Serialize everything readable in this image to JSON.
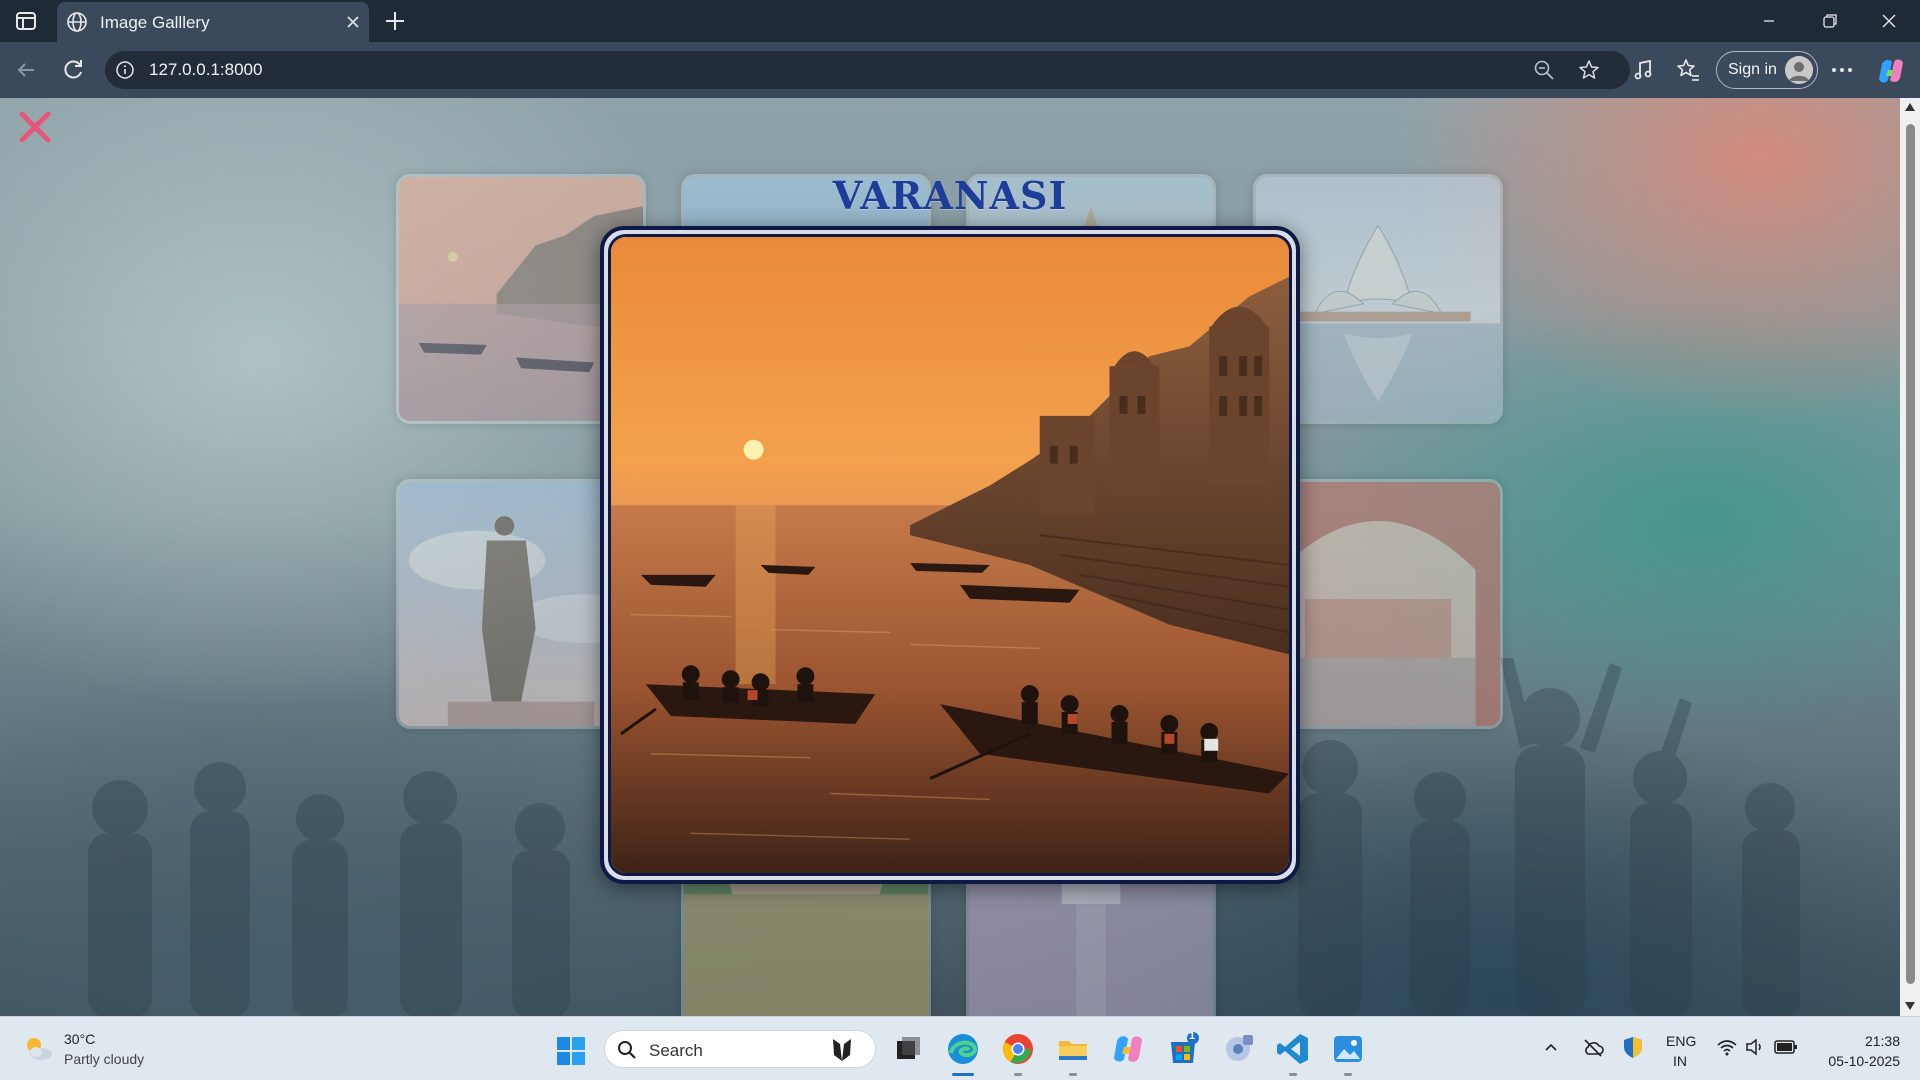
{
  "browser": {
    "tab_title": "Image Galllery",
    "url": "127.0.0.1:8000",
    "signin_label": "Sign in"
  },
  "gallery": {
    "modal_title": "VARANASI",
    "modal_image_alt": "Varanasi ghats at sunset with boats",
    "thumbnails": [
      {
        "subject": "Varanasi ghats sunset"
      },
      {
        "subject": "Coastal scene"
      },
      {
        "subject": "Temple"
      },
      {
        "subject": "Lotus Temple"
      },
      {
        "subject": "Statue of Unity"
      },
      {
        "subject": "Hawa Mahal"
      },
      {
        "subject": "Kerala houseboat"
      },
      {
        "subject": "Taj Mahal"
      }
    ]
  },
  "colors": {
    "title_blue": "#1e3d9a",
    "close_pink": "#e8557a",
    "frame_navy": "#0e1a45"
  },
  "taskbar": {
    "weather_temp": "30°C",
    "weather_desc": "Partly cloudy",
    "search_label": "Search",
    "store_badge": "1",
    "lang_line1": "ENG",
    "lang_line2": "IN",
    "time": "21:38",
    "date": "05-10-2025"
  }
}
